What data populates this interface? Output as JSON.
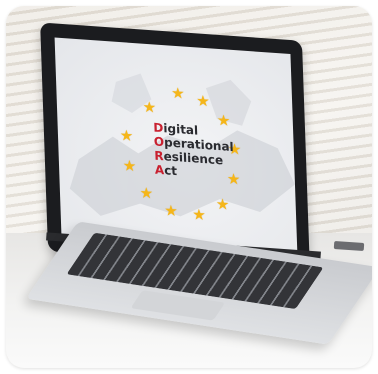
{
  "screen": {
    "title_lines": [
      {
        "initial": "D",
        "rest": "igital"
      },
      {
        "initial": "O",
        "rest": "perational"
      },
      {
        "initial": "R",
        "rest": "esilience"
      },
      {
        "initial": "A",
        "rest": "ct"
      }
    ],
    "star_symbol": "★",
    "star_count": 12,
    "star_color": "#f5b61a",
    "initial_color": "#c8202f"
  }
}
